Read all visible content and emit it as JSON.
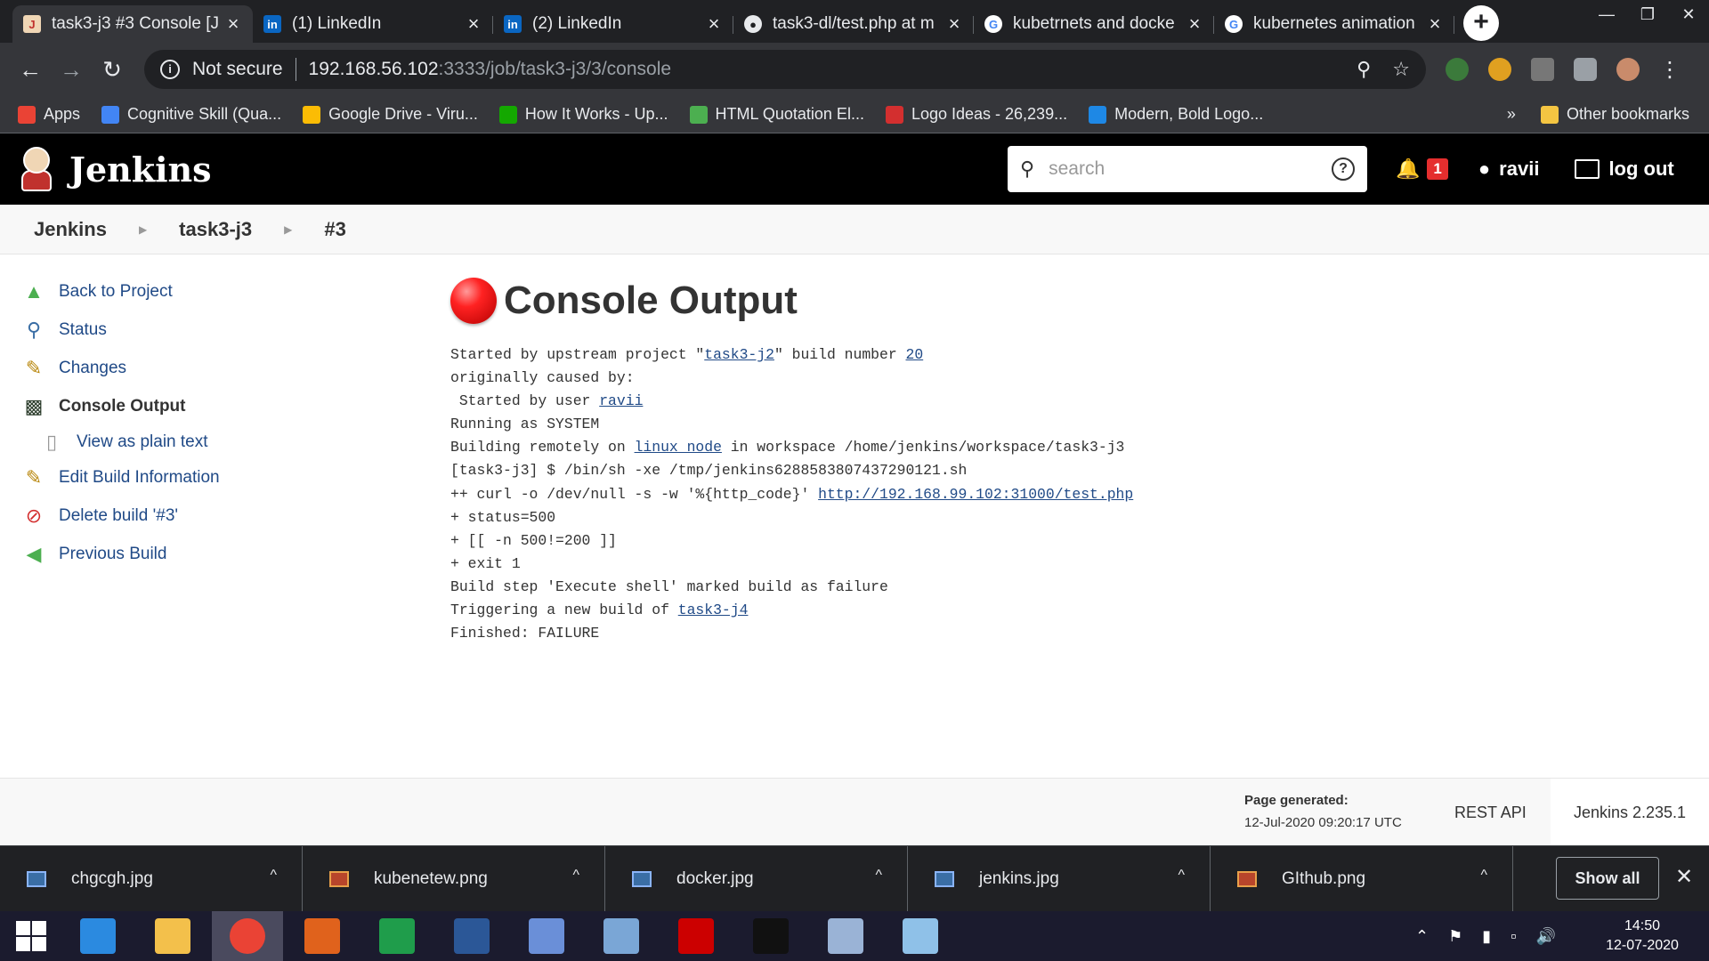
{
  "browser": {
    "tabs": [
      {
        "title": "task3-j3 #3 Console [J",
        "active": true,
        "favicon": "jenkins-icon"
      },
      {
        "title": "(1) LinkedIn",
        "active": false,
        "favicon": "linkedin-icon"
      },
      {
        "title": "(2) LinkedIn",
        "active": false,
        "favicon": "linkedin-icon"
      },
      {
        "title": "task3-dl/test.php at m",
        "active": false,
        "favicon": "github-icon"
      },
      {
        "title": "kubetrnets and docke",
        "active": false,
        "favicon": "google-icon"
      },
      {
        "title": "kubernetes animation",
        "active": false,
        "favicon": "google-icon"
      }
    ],
    "address": {
      "security_label": "Not secure",
      "host": "192.168.56.102",
      "rest": ":3333/job/task3-j3/3/console"
    },
    "bookmarks": [
      {
        "label": "Apps",
        "icon": "apps-grid-icon",
        "color": "#ea4335"
      },
      {
        "label": "Cognitive Skill (Qua...",
        "icon": "cognitive-icon",
        "color": "#4285f4"
      },
      {
        "label": "Google Drive - Viru...",
        "icon": "google-drive-icon",
        "color": "#fbbc04"
      },
      {
        "label": "How It Works - Up...",
        "icon": "upwork-icon",
        "color": "#14a800"
      },
      {
        "label": "HTML Quotation El...",
        "icon": "w3schools-icon",
        "color": "#4caf50"
      },
      {
        "label": "Logo Ideas - 26,239...",
        "icon": "logo-ideas-icon",
        "color": "#d32f2f"
      },
      {
        "label": "Modern, Bold Logo...",
        "icon": "modern-logo-icon",
        "color": "#1e88e5"
      }
    ],
    "bookmarks_more": "»",
    "other_bookmarks": "Other bookmarks"
  },
  "jenkins": {
    "title": "Jenkins",
    "search_placeholder": "search",
    "notification_count": "1",
    "user": "ravii",
    "logout": "log out",
    "breadcrumb": [
      "Jenkins",
      "task3-j3",
      "#3"
    ],
    "tasks": [
      {
        "label": "Back to Project",
        "icon": "up-arrow-icon"
      },
      {
        "label": "Status",
        "icon": "magnifier-icon"
      },
      {
        "label": "Changes",
        "icon": "notepad-icon"
      },
      {
        "label": "Console Output",
        "icon": "terminal-icon",
        "current": true
      },
      {
        "label": "View as plain text",
        "icon": "document-icon",
        "sub": true
      },
      {
        "label": "Edit Build Information",
        "icon": "notepad-icon"
      },
      {
        "label": "Delete build '#3'",
        "icon": "no-entry-icon"
      },
      {
        "label": "Previous Build",
        "icon": "left-arrow-icon"
      }
    ],
    "console_title": "Console Output",
    "console": [
      [
        {
          "t": "Started by upstream project \""
        },
        {
          "t": "task3-j2",
          "link": true
        },
        {
          "t": "\" build number "
        },
        {
          "t": "20",
          "link": true
        }
      ],
      [
        {
          "t": "originally caused by:"
        }
      ],
      [
        {
          "t": " Started by user "
        },
        {
          "t": "ravii",
          "link": true
        }
      ],
      [
        {
          "t": "Running as SYSTEM"
        }
      ],
      [
        {
          "t": "Building remotely on "
        },
        {
          "t": "linux_node",
          "link": true
        },
        {
          "t": " in workspace /home/jenkins/workspace/task3-j3"
        }
      ],
      [
        {
          "t": "[task3-j3] $ /bin/sh -xe /tmp/jenkins6288583807437290121.sh"
        }
      ],
      [
        {
          "t": "++ curl -o /dev/null -s -w '%{http_code}' "
        },
        {
          "t": "http://192.168.99.102:31000/test.php",
          "link": true
        }
      ],
      [
        {
          "t": "+ status=500"
        }
      ],
      [
        {
          "t": "+ [[ -n 500!=200 ]]"
        }
      ],
      [
        {
          "t": "+ exit 1"
        }
      ],
      [
        {
          "t": "Build step 'Execute shell' marked build as failure"
        }
      ],
      [
        {
          "t": "Triggering a new build of "
        },
        {
          "t": "task3-j4",
          "link": true
        }
      ],
      [
        {
          "t": "Finished: FAILURE"
        }
      ]
    ],
    "footer": {
      "page_generated_label": "Page generated:",
      "page_generated_value": "12-Jul-2020 09:20:17 UTC",
      "rest_api": "REST API",
      "version": "Jenkins 2.235.1"
    }
  },
  "downloads": {
    "items": [
      {
        "name": "chgcgh.jpg",
        "type": "jpg"
      },
      {
        "name": "kubenetew.png",
        "type": "png"
      },
      {
        "name": "docker.jpg",
        "type": "jpg"
      },
      {
        "name": "jenkins.jpg",
        "type": "jpg"
      },
      {
        "name": "GIthub.png",
        "type": "png"
      }
    ],
    "show_all": "Show all"
  },
  "taskbar": {
    "apps": [
      {
        "name": "internet-explorer-icon",
        "color": "#2b8ae0"
      },
      {
        "name": "file-explorer-icon",
        "color": "#f3c04b"
      },
      {
        "name": "chrome-icon",
        "color": "#ea4335",
        "active": true
      },
      {
        "name": "matlab-icon",
        "color": "#e0621c"
      },
      {
        "name": "excel-icon",
        "color": "#1f9d4b"
      },
      {
        "name": "word-icon",
        "color": "#2b5797"
      },
      {
        "name": "network-icon",
        "color": "#6a8fd8"
      },
      {
        "name": "virtualbox-icon",
        "color": "#7aa6d6"
      },
      {
        "name": "redhat-icon",
        "color": "#cc0000"
      },
      {
        "name": "terminal-icon",
        "color": "#111111"
      },
      {
        "name": "paint-icon",
        "color": "#9ab3d6"
      },
      {
        "name": "notepad-icon",
        "color": "#8fc1e8"
      }
    ],
    "time": "14:50",
    "date": "12-07-2020"
  }
}
